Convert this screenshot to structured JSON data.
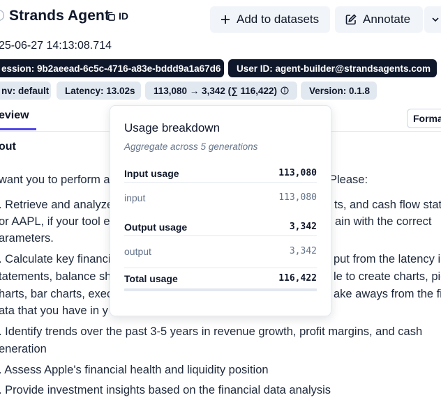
{
  "header": {
    "title": "Strands Agent",
    "id_label": "ID",
    "add_to_datasets": "Add to datasets",
    "annotate": "Annotate",
    "timestamp": "25-06-27 14:13:08.714"
  },
  "badges": {
    "session": "ession: 9b2aeead-6c5c-4716-a83e-bddd9a1a67d6",
    "user": "User ID: agent-builder@strandsagents.com",
    "env": "nv: default",
    "latency": "Latency: 13.02s",
    "tokens": "113,080 → 3,342 (∑ 116,422)",
    "version": "Version: 0.1.8"
  },
  "tabs": {
    "preview": "eview",
    "format": "Forma"
  },
  "section": {
    "label": "out"
  },
  "content": {
    "lines": [
      "want you to perform a",
      "Please:",
      ". Retrieve and analyze",
      "ts, and cash flow state",
      "or AAPL, if your tool e",
      "ain with the correct",
      "arameters.",
      ". Calculate key financi",
      "put from the latency i",
      "tatements, balance sh",
      "le to create charts, pie",
      "harts, bar charts, execu",
      "ake aways from the fin",
      "ata that you have in y",
      ". Identify trends over the past 3-5 years in revenue growth, profit margins, and cash",
      "eneration",
      ". Assess Apple's financial health and liquidity position",
      ". Provide investment insights based on the financial data analysis"
    ]
  },
  "popover": {
    "title": "Usage breakdown",
    "subtitle": "Aggregate across 5 generations",
    "rows": [
      {
        "label": "Input usage",
        "value": "113,080"
      },
      {
        "label": "input",
        "value": "113,080"
      },
      {
        "label": "Output usage",
        "value": "3,342"
      },
      {
        "label": "output",
        "value": "3,342"
      },
      {
        "label": "Total usage",
        "value": "116,422"
      }
    ]
  },
  "colors": {
    "dark_chip": "#0f172a",
    "light_chip": "#e2e8f0",
    "accent": "#4f46e5"
  },
  "icons": [
    "copy-icon",
    "plus-icon",
    "edit-icon",
    "chevron-down-icon",
    "info-icon"
  ]
}
